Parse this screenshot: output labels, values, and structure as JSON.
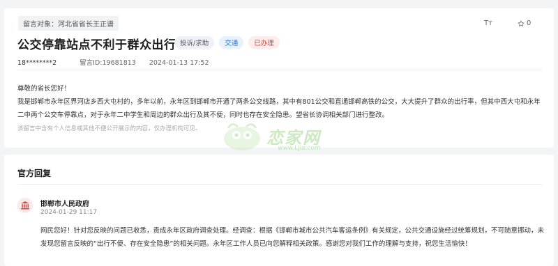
{
  "message": {
    "target_label": "留言对象：河北省省长王正谱",
    "font_tool_label": "Tт",
    "favorite_count": "0",
    "title": "公交停靠站点不利于群众出行",
    "tags": {
      "type": "投诉/求助",
      "category": "交通",
      "status": "已办理"
    },
    "user": "18********2",
    "message_id": "留言ID:19681813",
    "datetime": "2024-01-13 17:52",
    "greeting": "尊敬的省长您好！",
    "content": "我是邯郸市永年区界河店乡西大屯村的，多年以前，永年区到邯郸市开通了两条公交线路，其中有801公交和直通邯郸高铁的公交，大大提升了群众的出行率，但其中西大屯和永年二中两个公交车停靠点，对于永年二中学生和周边的群众出行及其不便，同时也存在安全隐患。望省长协调相关部门进行整改。",
    "privacy_notice": "该留言中含有个人信息或其他不便公开展示的内容，仅办理机构可见。"
  },
  "watermark": {
    "text": "恋家网",
    "url": "www.Ljia.com"
  },
  "reply": {
    "section_title": "官方回复",
    "responder": "邯郸市人民政府",
    "datetime": "2024-01-29 11:17",
    "content": "网民您好！针对您反映的问题已收悉，责成永年区政府调查处理。经调查：根据《邯郸市城市公共汽车客运条例》有关规定，公共交通设施经过统筹规划，不可随意挪动，未发现您留言反映的“出行不便、存在安全隐患”的相关问题。永年区工作人员已向您解释相关政策。感谢您对我们工作的理解与支持，祝您生活愉快！"
  }
}
